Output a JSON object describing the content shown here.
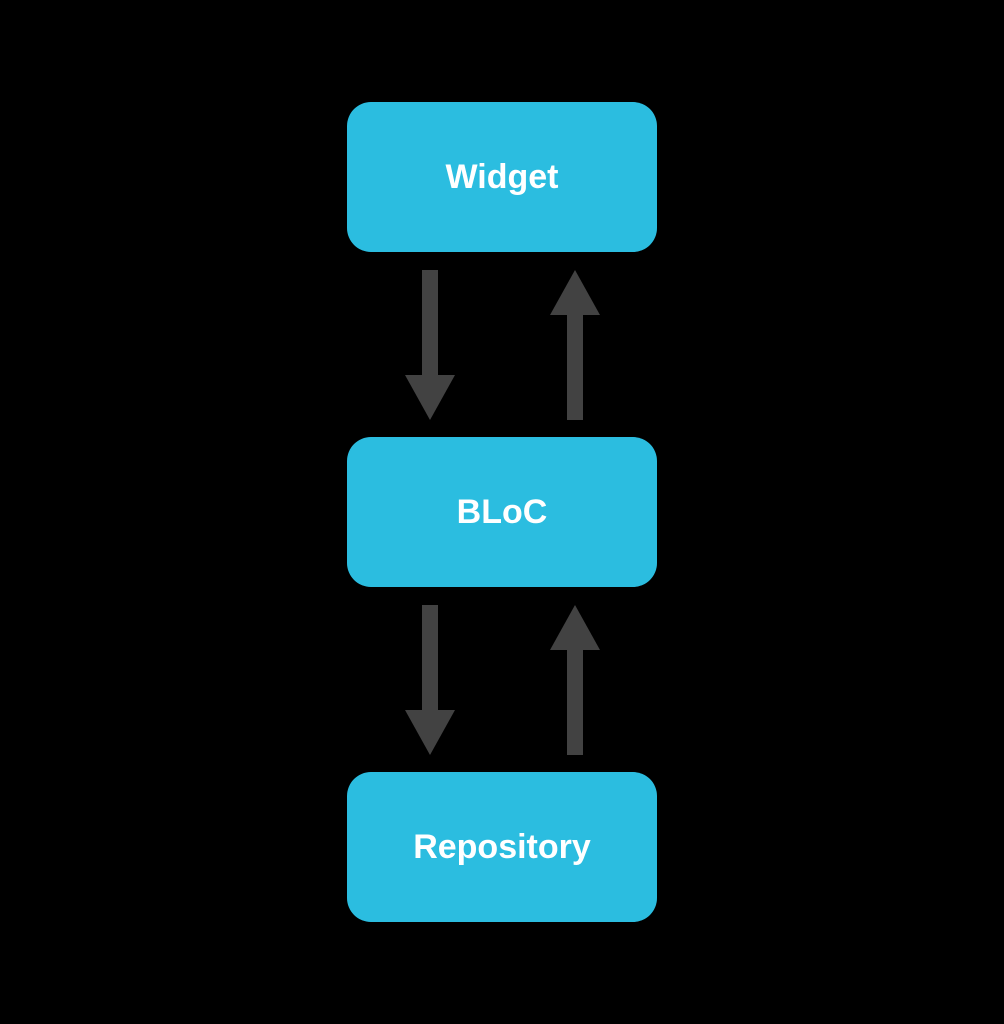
{
  "nodes": {
    "widget": {
      "label": "Widget"
    },
    "bloc": {
      "label": "BLoC"
    },
    "repository": {
      "label": "Repository"
    }
  },
  "colors": {
    "node_bg": "#2BBDE0",
    "node_text": "#ffffff",
    "arrow": "#424242",
    "background": "#000000"
  }
}
